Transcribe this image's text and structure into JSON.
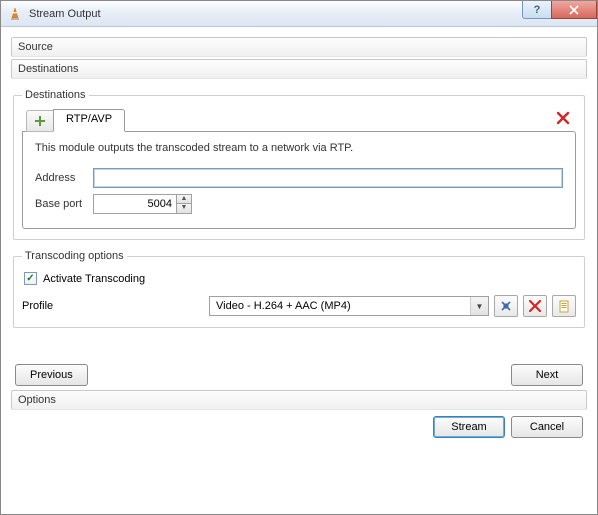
{
  "window": {
    "title": "Stream Output"
  },
  "sections": {
    "source": "Source",
    "destinations": "Destinations",
    "options": "Options"
  },
  "dest": {
    "group_label": "Destinations",
    "tab_label": "RTP/AVP",
    "description": "This module outputs the transcoded stream to a network via RTP.",
    "address_label": "Address",
    "address_value": "",
    "baseport_label": "Base port",
    "baseport_value": "5004"
  },
  "trans": {
    "group_label": "Transcoding options",
    "activate_label": "Activate Transcoding",
    "activate_checked": true,
    "profile_label": "Profile",
    "profile_value": "Video - H.264 + AAC (MP4)"
  },
  "nav": {
    "previous": "Previous",
    "next": "Next"
  },
  "actions": {
    "stream": "Stream",
    "cancel": "Cancel"
  }
}
